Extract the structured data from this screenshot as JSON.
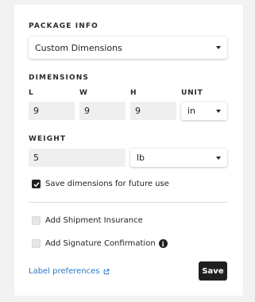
{
  "package_info": {
    "title": "PACKAGE INFO",
    "selected": "Custom Dimensions"
  },
  "dimensions": {
    "title": "DIMENSIONS",
    "labels": {
      "length": "L",
      "width": "W",
      "height": "H",
      "unit": "UNIT"
    },
    "values": {
      "length": "9",
      "width": "9",
      "height": "9"
    },
    "unit": "in"
  },
  "weight": {
    "title": "WEIGHT",
    "value": "5",
    "unit": "lb"
  },
  "options": {
    "save_dimensions": {
      "label": "Save dimensions for future use",
      "checked": true
    },
    "shipment_insurance": {
      "label": "Add Shipment Insurance",
      "checked": false
    },
    "signature_confirmation": {
      "label": "Add Signature Confirmation",
      "checked": false,
      "info_icon": "i"
    }
  },
  "footer": {
    "label_preferences": "Label preferences",
    "save_label": "Save"
  },
  "colors": {
    "link": "#2a78c4",
    "button": "#1f1f1f",
    "input_bg": "#efefef",
    "page_bg": "#f2f2f2"
  }
}
